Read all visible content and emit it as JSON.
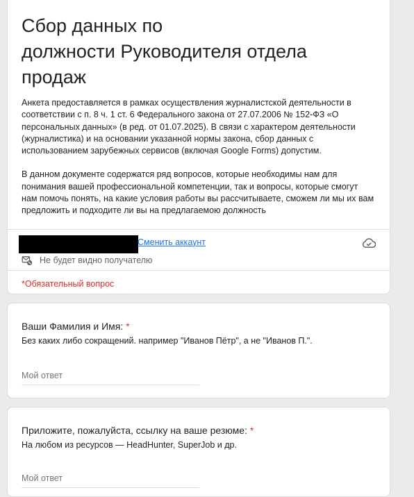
{
  "form": {
    "title": "Сбор данных по\nдолжности Руководителя отдела\nпродаж",
    "description_paragraphs": [
      "Анкета предоставляется в рамках осуществления журналистской деятельности в соответствии с п. 8 ч. 1 ст. 6 Федерального закона от 27.07.2006 № 152-ФЗ «О персональных данных» (в ред. от 01.07.2025). В связи с характером деятельности (журналистика) и на основании указанной нормы закона, сбор данных с использованием зарубежных сервисов (включая Google Forms) допустим.",
      "В данном документе содержатся ряд вопросов, которые необходимы нам для понимания вашей профессиональной компетенции, так и вопросы, которые смогут нам помочь понять, на какие условия работы вы рассчитываете, сможем ли мы их вам предложить и подходите ли вы на предлагаемою должность"
    ]
  },
  "account": {
    "switch_label": "Сменить аккаунт",
    "not_visible_label": "Не будет видно получателю"
  },
  "required_note": "*Обязательный вопрос",
  "questions": [
    {
      "title": "Ваши Фамилия и Имя:",
      "required_mark": "*",
      "help": "Без каких либо сокращений. например \"Иванов Пётр\", а не \"Иванов П.\".",
      "placeholder": "Мой ответ",
      "value": ""
    },
    {
      "title": "Приложите, пожалуйста, ссылку на ваше резюме:",
      "required_mark": "*",
      "help": "На любом из ресурсов — HeadHunter, SuperJob и др.",
      "placeholder": "Мой ответ",
      "value": ""
    }
  ],
  "icons": {
    "cloud": "cloud-saved-icon",
    "hidden": "hidden-mail-icon"
  },
  "colors": {
    "link": "#1a73e8",
    "required": "#d93025",
    "background": "#ebebeb"
  }
}
